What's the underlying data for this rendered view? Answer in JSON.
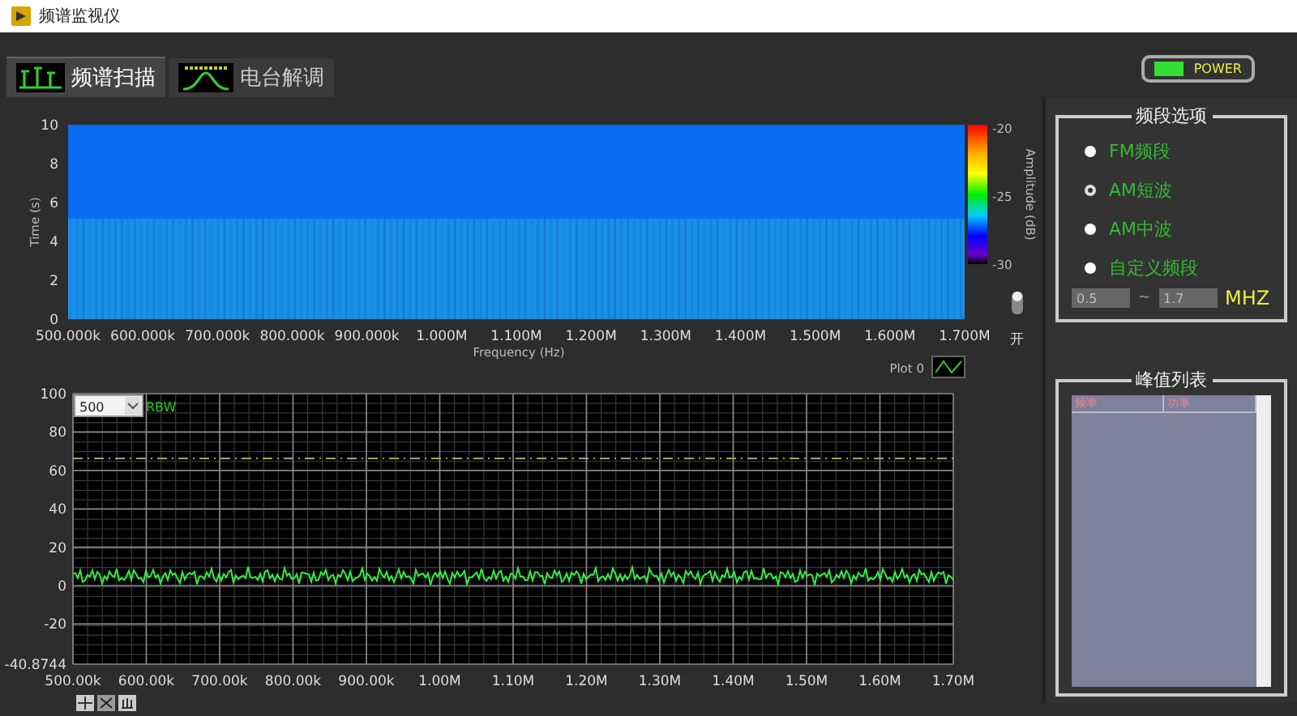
{
  "window": {
    "title": "频谱监视仪"
  },
  "tabs": [
    {
      "label": "频谱扫描",
      "selected": true
    },
    {
      "label": "电台解调",
      "selected": false
    }
  ],
  "power_button": {
    "label": "POWER",
    "on": true
  },
  "spectrogram": {
    "y_label": "Time (s)",
    "y_ticks": [
      "10",
      "8",
      "6",
      "4",
      "2",
      "0"
    ],
    "x_ticks": [
      "500.000k",
      "600.000k",
      "700.000k",
      "800.000k",
      "900.000k",
      "1.000M",
      "1.100M",
      "1.200M",
      "1.300M",
      "1.400M",
      "1.500M",
      "1.600M",
      "1.700M"
    ],
    "x_label": "Frequency (Hz)",
    "colorbar_label": "Amplitude (dB)",
    "colorbar_ticks": [
      "-20",
      "-25",
      "-30"
    ],
    "plot_legend": "Plot 0"
  },
  "switch": {
    "label": "开",
    "on": true
  },
  "spectrum": {
    "rbw_value": "500",
    "rbw_label": "RBW",
    "y_ticks": [
      "100",
      "80",
      "60",
      "40",
      "20",
      "0",
      "-20",
      "-40.8744"
    ],
    "x_ticks": [
      "500.00k",
      "600.00k",
      "700.00k",
      "800.00k",
      "900.00k",
      "1.00M",
      "1.10M",
      "1.20M",
      "1.30M",
      "1.40M",
      "1.50M",
      "1.60M",
      "1.70M"
    ]
  },
  "band_group": {
    "title": "频段选项",
    "options": [
      {
        "label": "FM频段",
        "selected": false
      },
      {
        "label": "AM短波",
        "selected": true
      },
      {
        "label": "AM中波",
        "selected": false
      },
      {
        "label": "自定义频段",
        "selected": false
      }
    ],
    "range_from": "0.5",
    "range_sep": "~",
    "range_to": "1.7",
    "unit": "MHZ"
  },
  "peak_group": {
    "title": "峰值列表",
    "columns": [
      "频率",
      "功率"
    ]
  }
}
